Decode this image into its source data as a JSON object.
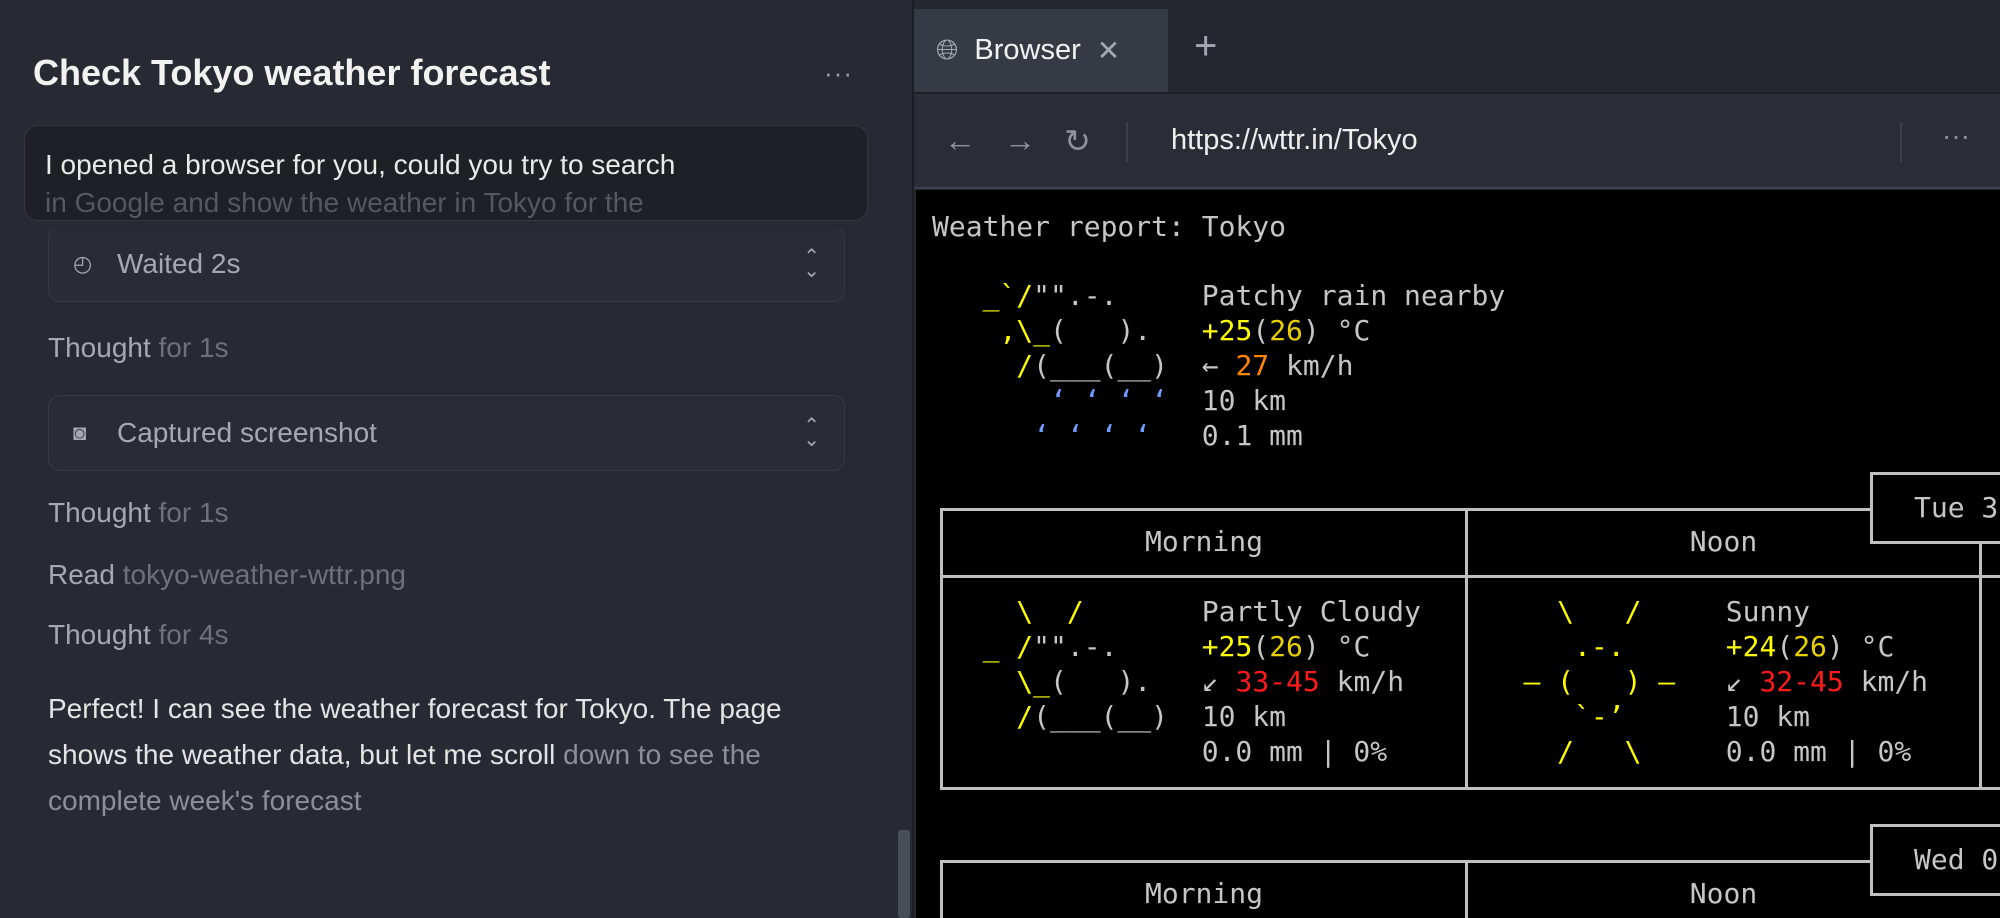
{
  "left": {
    "title": "Check Tokyo weather forecast",
    "menu": "···",
    "message": {
      "line1": "I opened a browser for you, could you try to search",
      "line2": "in Google and show the weather in Tokyo for the"
    },
    "steps": [
      {
        "type": "tool",
        "icon": "clock-icon",
        "label": "Waited 2s"
      },
      {
        "type": "thought",
        "label": "Thought",
        "detail": "for 1s"
      },
      {
        "type": "tool",
        "icon": "camera-icon",
        "label": "Captured screenshot"
      },
      {
        "type": "thought",
        "label": "Thought",
        "detail": "for 1s"
      },
      {
        "type": "read",
        "label": "Read",
        "detail": "tokyo-weather-wttr.png"
      },
      {
        "type": "thought",
        "label": "Thought",
        "detail": "for 4s"
      }
    ],
    "response": {
      "text": "Perfect! I can see the weather forecast for Tokyo. The page shows the weather data, but let me scroll",
      "faded": " down to see the complete week's forecast"
    }
  },
  "browser": {
    "tab_label": "Browser",
    "url": "https://wttr.in/Tokyo",
    "more": "···"
  },
  "colors": {
    "yellow": "#ffff00",
    "orange": "#ff8700",
    "red": "#ff1a1a",
    "rain": "#6f9cff"
  },
  "weather": {
    "heading": "Weather report: Tokyo",
    "current": [
      [
        [
          "   ",
          "w"
        ],
        [
          "_`/",
          "y"
        ],
        [
          "\"\".-.",
          "w"
        ],
        [
          "     Patchy rain nearby",
          "w"
        ]
      ],
      [
        [
          "    ",
          "w"
        ],
        [
          ",\\_",
          "y"
        ],
        [
          "(   ).",
          "w"
        ],
        [
          "   ",
          "w"
        ],
        [
          "+25",
          "y"
        ],
        [
          "(",
          "w"
        ],
        [
          "26",
          "y2"
        ],
        [
          ") °C",
          "w"
        ]
      ],
      [
        [
          "     ",
          "w"
        ],
        [
          "/",
          "y"
        ],
        [
          "(___(__)",
          "w"
        ],
        [
          "  ← ",
          "w"
        ],
        [
          "27",
          "o"
        ],
        [
          " km/h",
          "w"
        ]
      ],
      [
        [
          "       ",
          "w"
        ],
        [
          "‘ ‘ ‘ ‘",
          "b"
        ],
        [
          "  10 km",
          "w"
        ]
      ],
      [
        [
          "      ",
          "w"
        ],
        [
          "‘ ‘ ‘ ‘",
          "b"
        ],
        [
          "   0.1 mm",
          "w"
        ]
      ]
    ],
    "days": [
      {
        "date": "Tue 3",
        "periods": [
          {
            "name": "Morning",
            "lines": [
              [
                [
                  "     ",
                  "w"
                ],
                [
                  "\\  /",
                  "y"
                ],
                [
                  "       Partly Cloudy",
                  "w"
                ]
              ],
              [
                [
                  "   ",
                  "w"
                ],
                [
                  "_ /",
                  "y"
                ],
                [
                  "\"\".-.",
                  "w"
                ],
                [
                  "     ",
                  "w"
                ],
                [
                  "+25",
                  "y"
                ],
                [
                  "(",
                  "w"
                ],
                [
                  "26",
                  "y2"
                ],
                [
                  ") °C",
                  "w"
                ]
              ],
              [
                [
                  "     ",
                  "w"
                ],
                [
                  "\\_",
                  "y"
                ],
                [
                  "(   ).",
                  "w"
                ],
                [
                  "   ↙ ",
                  "w"
                ],
                [
                  "33-45",
                  "r"
                ],
                [
                  " km/h",
                  "w"
                ]
              ],
              [
                [
                  "     ",
                  "w"
                ],
                [
                  "/",
                  "y"
                ],
                [
                  "(___(__)",
                  "w"
                ],
                [
                  "  10 km",
                  "w"
                ]
              ],
              [
                [
                  "                0.0 mm | 0%",
                  "w"
                ]
              ]
            ]
          },
          {
            "name": "Noon",
            "lines": [
              [
                [
                  "      ",
                  "w"
                ],
                [
                  "\\   /",
                  "y"
                ],
                [
                  "     Sunny",
                  "w"
                ]
              ],
              [
                [
                  "       ",
                  "w"
                ],
                [
                  ".-.",
                  "y"
                ],
                [
                  "      ",
                  "w"
                ],
                [
                  "+24",
                  "y"
                ],
                [
                  "(",
                  "w"
                ],
                [
                  "26",
                  "y2"
                ],
                [
                  ") °C",
                  "w"
                ]
              ],
              [
                [
                  "    ",
                  "w"
                ],
                [
                  "― (   ) ―",
                  "y"
                ],
                [
                  "   ↙ ",
                  "w"
                ],
                [
                  "32-45",
                  "r"
                ],
                [
                  " km/h",
                  "w"
                ]
              ],
              [
                [
                  "       ",
                  "w"
                ],
                [
                  "`-’",
                  "y"
                ],
                [
                  "      10 km",
                  "w"
                ]
              ],
              [
                [
                  "      ",
                  "w"
                ],
                [
                  "/   \\",
                  "y"
                ],
                [
                  "     0.0 mm | 0%",
                  "w"
                ]
              ]
            ]
          }
        ]
      },
      {
        "date": "Wed 0",
        "periods": [
          {
            "name": "Morning"
          },
          {
            "name": "Noon"
          }
        ]
      }
    ]
  }
}
